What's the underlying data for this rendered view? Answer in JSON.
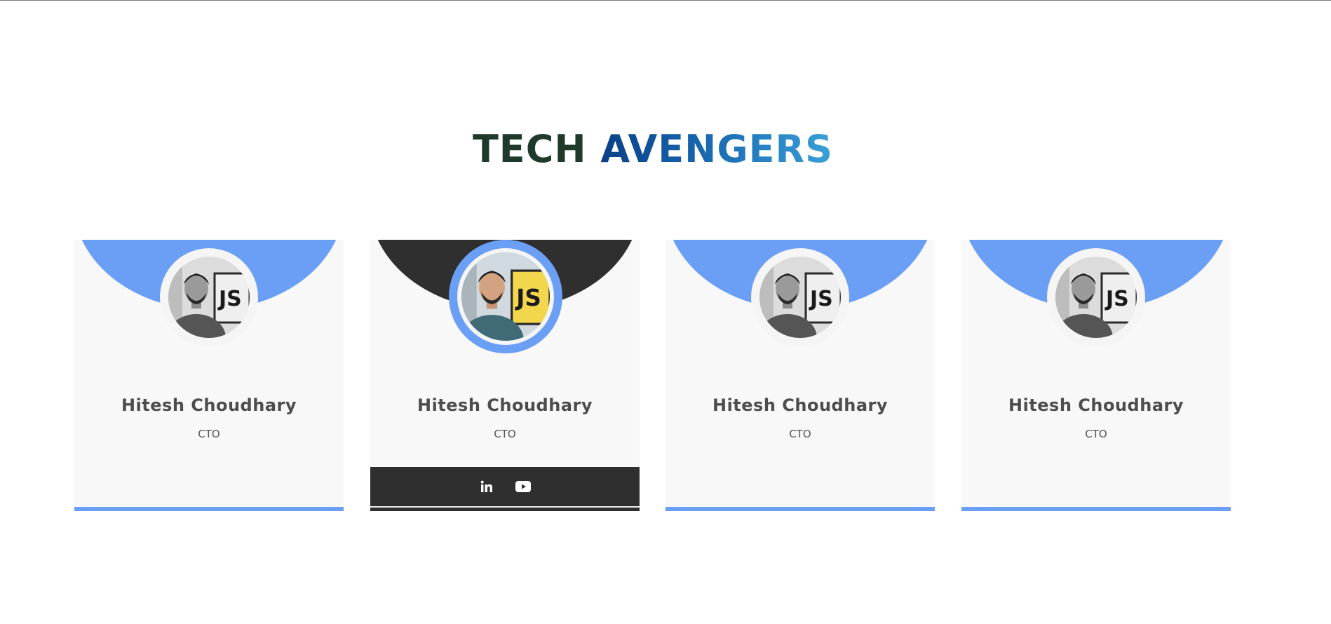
{
  "heading": {
    "word1": "TECH",
    "word2": "AVENGERS"
  },
  "cards": [
    {
      "name": "Hitesh Choudhary",
      "role": "CTO",
      "photo": "profile-photo-grayscale",
      "state": "default"
    },
    {
      "name": "Hitesh Choudhary",
      "role": "CTO",
      "photo": "profile-photo-color",
      "state": "hover",
      "social": [
        "linkedin-icon",
        "youtube-icon"
      ]
    },
    {
      "name": "Hitesh Choudhary",
      "role": "CTO",
      "photo": "profile-photo-grayscale",
      "state": "default"
    },
    {
      "name": "Hitesh Choudhary",
      "role": "CTO",
      "photo": "profile-photo-grayscale",
      "state": "default"
    }
  ],
  "colors": {
    "accent_blue": "#6a9ff5",
    "dark": "#2f2f2f",
    "card_bg": "#f8f8f8",
    "heading_dark_green": "#1f3a2b",
    "heading_blue": "#0a3f86",
    "heading_light_blue": "#3aa0d8"
  }
}
